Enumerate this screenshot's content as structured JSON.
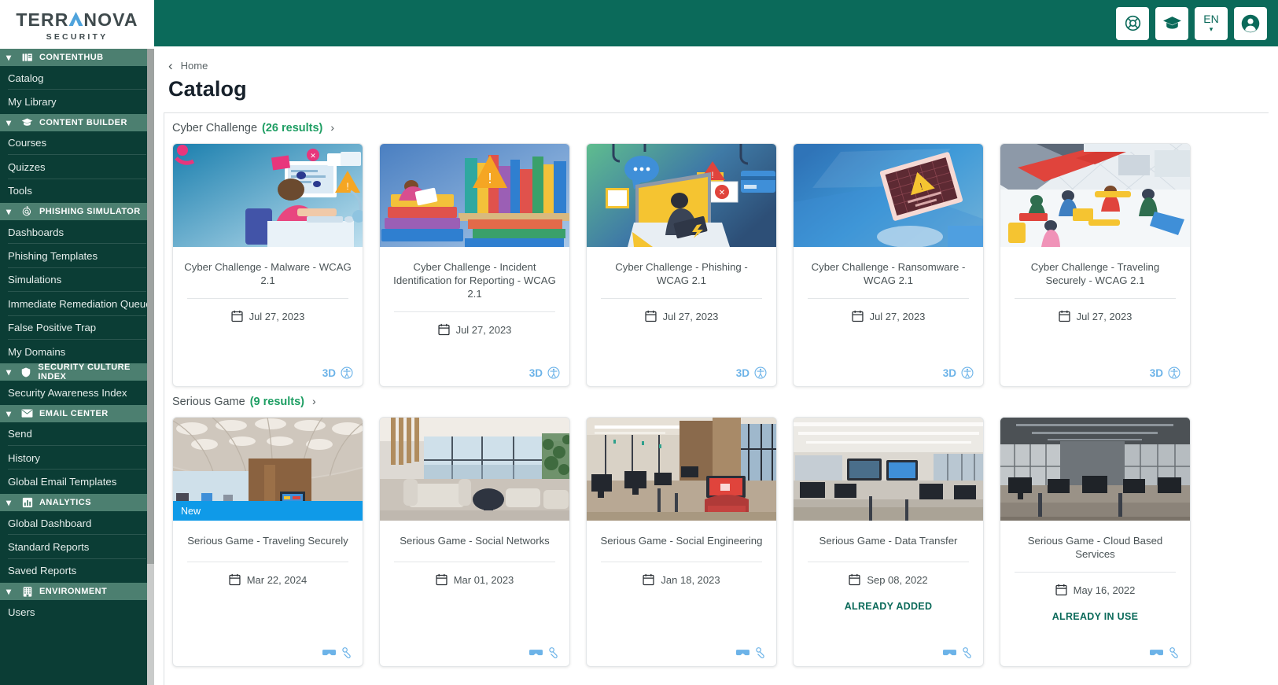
{
  "brand": {
    "logo_main_left": "TERR",
    "logo_main_right": "NOVA",
    "logo_sub": "SECURITY",
    "accent_color": "#4fa3dc",
    "primary_color": "#0b6a5a",
    "sidebar_color": "#0b3d35",
    "section_header_color": "#4c7f70"
  },
  "topbar": {
    "buttons": [
      {
        "name": "help-icon",
        "label": ""
      },
      {
        "name": "training-icon",
        "label": ""
      },
      {
        "name": "language-selector",
        "label": "EN"
      },
      {
        "name": "account-icon",
        "label": ""
      }
    ],
    "language": "EN"
  },
  "sidebar": {
    "sections": [
      {
        "label": "CONTENTHUB",
        "icon": "contenthub-icon",
        "items": [
          "Catalog",
          "My Library"
        ]
      },
      {
        "label": "CONTENT BUILDER",
        "icon": "content-builder-icon",
        "items": [
          "Courses",
          "Quizzes",
          "Tools"
        ]
      },
      {
        "label": "PHISHING SIMULATOR",
        "icon": "phishing-simulator-icon",
        "items": [
          "Dashboards",
          "Phishing Templates",
          "Simulations",
          "Immediate Remediation Queue",
          "False Positive Trap",
          "My Domains"
        ]
      },
      {
        "label": "SECURITY CULTURE INDEX",
        "icon": "shield-icon",
        "items": [
          "Security Awareness Index"
        ]
      },
      {
        "label": "EMAIL CENTER",
        "icon": "envelope-icon",
        "items": [
          "Send",
          "History",
          "Global Email Templates"
        ]
      },
      {
        "label": "ANALYTICS",
        "icon": "analytics-icon",
        "items": [
          "Global Dashboard",
          "Standard Reports",
          "Saved Reports"
        ]
      },
      {
        "label": "ENVIRONMENT",
        "icon": "environment-icon",
        "items": [
          "Users"
        ]
      }
    ]
  },
  "breadcrumb": {
    "back_icon": "chevron-left-icon",
    "label": "Home"
  },
  "page": {
    "title": "Catalog"
  },
  "groups": [
    {
      "name": "Cyber Challenge",
      "count_label": "(26 results)",
      "arrow_icon": "chevron-right-icon",
      "cards": [
        {
          "title": "Cyber Challenge - Malware - WCAG 2.1",
          "date": "Jul 27, 2023",
          "date_icon": "calendar-icon",
          "badge": null,
          "status": null,
          "foot_label": "3D",
          "foot_icon": "accessibility-icon",
          "thumb_style": "malware"
        },
        {
          "title": "Cyber Challenge - Incident Identification for Reporting - WCAG 2.1",
          "date": "Jul 27, 2023",
          "date_icon": "calendar-icon",
          "badge": null,
          "status": null,
          "foot_label": "3D",
          "foot_icon": "accessibility-icon",
          "thumb_style": "incident"
        },
        {
          "title": "Cyber Challenge - Phishing - WCAG 2.1",
          "date": "Jul 27, 2023",
          "date_icon": "calendar-icon",
          "badge": null,
          "status": null,
          "foot_label": "3D",
          "foot_icon": "accessibility-icon",
          "thumb_style": "phishing"
        },
        {
          "title": "Cyber Challenge - Ransomware - WCAG 2.1",
          "date": "Jul 27, 2023",
          "date_icon": "calendar-icon",
          "badge": null,
          "status": null,
          "foot_label": "3D",
          "foot_icon": "accessibility-icon",
          "thumb_style": "ransomware"
        },
        {
          "title": "Cyber Challenge - Traveling Securely - WCAG 2.1",
          "date": "Jul 27, 2023",
          "date_icon": "calendar-icon",
          "badge": null,
          "status": null,
          "foot_label": "3D",
          "foot_icon": "accessibility-icon",
          "thumb_style": "traveling"
        }
      ]
    },
    {
      "name": "Serious Game",
      "count_label": "(9 results)",
      "arrow_icon": "chevron-right-icon",
      "cards": [
        {
          "title": "Serious Game - Traveling Securely",
          "date": "Mar 22, 2024",
          "date_icon": "calendar-icon",
          "badge": "New",
          "status": null,
          "foot_label": "",
          "foot_icon": "vr-icons",
          "thumb_style": "airport"
        },
        {
          "title": "Serious Game - Social Networks",
          "date": "Mar 01, 2023",
          "date_icon": "calendar-icon",
          "badge": null,
          "status": null,
          "foot_label": "",
          "foot_icon": "vr-icons",
          "thumb_style": "lounge"
        },
        {
          "title": "Serious Game - Social Engineering",
          "date": "Jan 18, 2023",
          "date_icon": "calendar-icon",
          "badge": null,
          "status": null,
          "foot_label": "",
          "foot_icon": "vr-icons",
          "thumb_style": "office-red"
        },
        {
          "title": "Serious Game - Data Transfer",
          "date": "Sep 08, 2022",
          "date_icon": "calendar-icon",
          "badge": null,
          "status": "ALREADY ADDED",
          "foot_label": "",
          "foot_icon": "vr-icons",
          "thumb_style": "office-bright"
        },
        {
          "title": "Serious Game - Cloud Based Services",
          "date": "May 16, 2022",
          "date_icon": "calendar-icon",
          "badge": null,
          "status": "ALREADY IN USE",
          "foot_label": "",
          "foot_icon": "vr-icons",
          "thumb_style": "office-dark"
        }
      ]
    }
  ]
}
